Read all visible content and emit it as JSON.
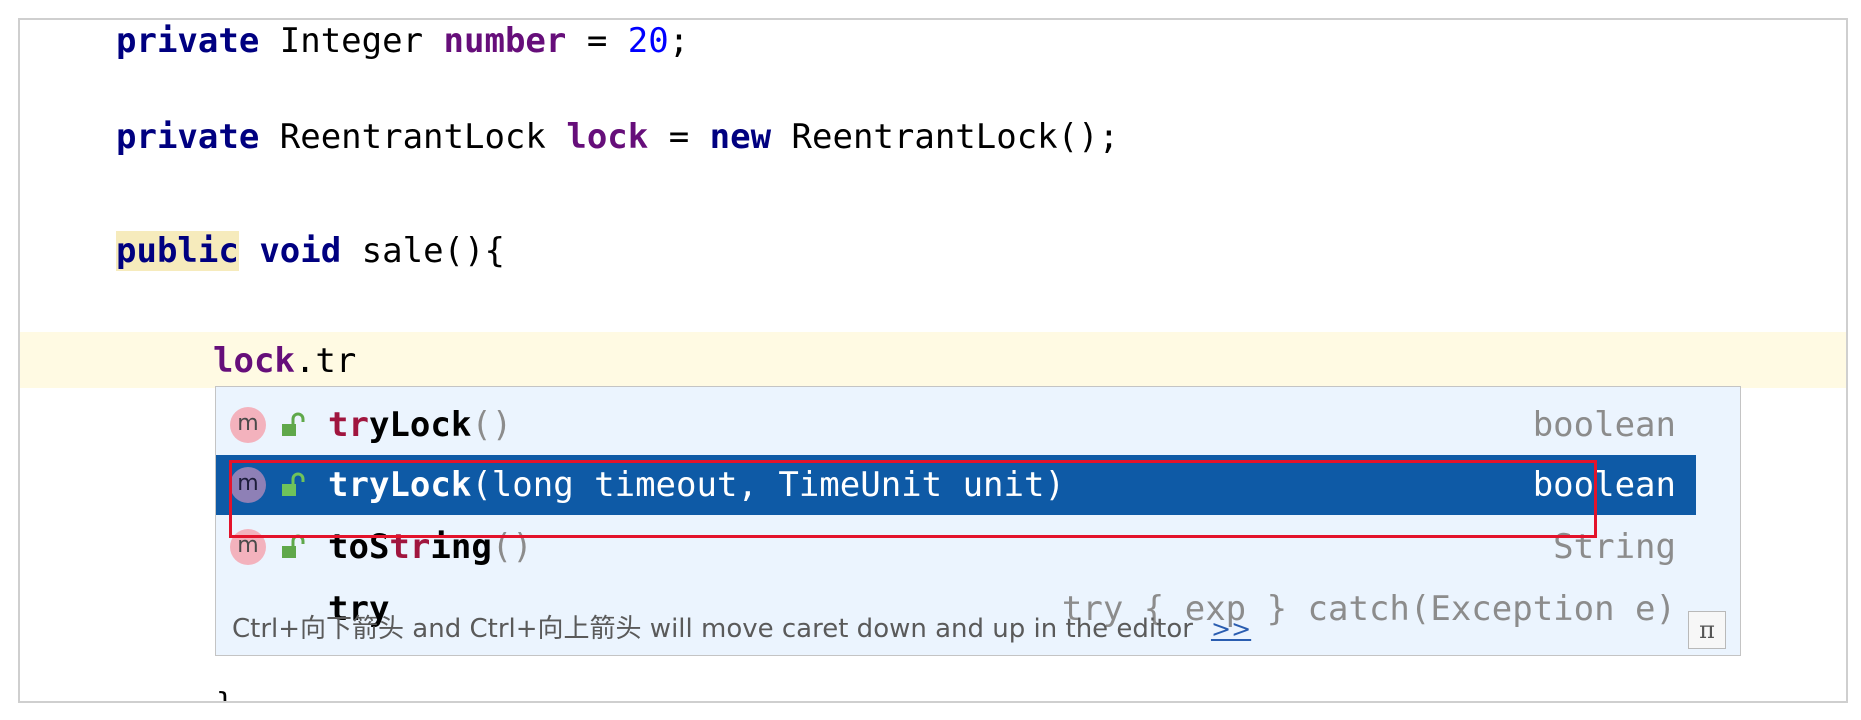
{
  "editor": {
    "line1": {
      "kw": "private",
      "type": " Integer ",
      "field": "number",
      "rest": " = ",
      "num": "20",
      "end": ";"
    },
    "line2": {
      "kw": "private",
      "type": " ReentrantLock ",
      "field": "lock",
      "rest": " = ",
      "kw2": "new",
      "ctor": " ReentrantLock();"
    },
    "line3": {
      "kw": "public",
      "kw2": "void",
      "rest": " sale(){"
    },
    "line4": {
      "field": "lock",
      "rest": ".tr"
    },
    "line5_brace": "}"
  },
  "completion": {
    "items": [
      {
        "badge": "m",
        "name_match": "tr",
        "name_rest": "yLock",
        "params": "()",
        "return_type": "boolean",
        "selected": false
      },
      {
        "badge": "m",
        "name_match": "tr",
        "name_rest": "yLock",
        "params": "(long timeout, TimeUnit unit)",
        "return_type": "boolean",
        "selected": true
      },
      {
        "badge": "m",
        "name_pre": "toS",
        "name_match": "tr",
        "name_rest": "ing",
        "params": "()",
        "return_type": "String",
        "selected": false
      },
      {
        "name": "try",
        "description": "try { exp } catch(Exception e)"
      }
    ],
    "footer_text": "Ctrl+向下箭头 and Ctrl+向上箭头 will move caret down and up in the editor",
    "footer_link": ">>",
    "pi_button": "π"
  },
  "colors": {
    "selection": "#0e5aa6",
    "highlight_box": "#e3132b",
    "popup_bg": "#ebf4fe"
  },
  "icons": {
    "method_badge": "method-icon",
    "visibility": "public-lock-icon"
  }
}
